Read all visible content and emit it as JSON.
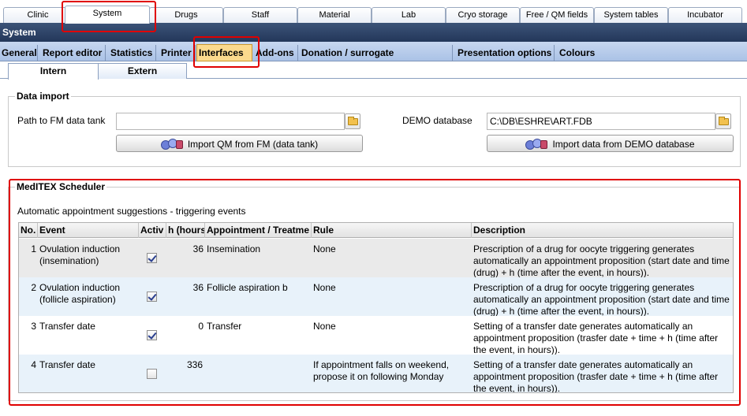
{
  "top_tabs": [
    "Clinic",
    "System",
    "Drugs",
    "Staff",
    "Material",
    "Lab",
    "Cryo storage",
    "Free / QM fields",
    "System tables",
    "Incubator"
  ],
  "active_top_tab": "System",
  "section_title": "System",
  "sub_tabs": [
    "General",
    "Report editor",
    "Statistics",
    "Printer",
    "Interfaces",
    "Add-ons",
    "Donation / surrogate motherhood",
    "Presentation options",
    "Colours"
  ],
  "active_sub_tab": "Interfaces",
  "third_tabs": [
    "Intern",
    "Extern"
  ],
  "active_third_tab": "Intern",
  "data_import": {
    "title": "Data import",
    "fm_label": "Path to FM data tank",
    "fm_value": "",
    "fm_button": "Import QM from FM (data tank)",
    "demo_label": "DEMO database",
    "demo_value": "C:\\DB\\ESHRE\\ART.FDB",
    "demo_button": "Import data from DEMO database"
  },
  "scheduler": {
    "title": "MedITEX Scheduler",
    "subtitle": "Automatic appointment suggestions - triggering events",
    "columns": [
      "No.",
      "Event",
      "Activ",
      "h (hours",
      "Appointment / Treatme",
      "Rule",
      "Description"
    ],
    "rows": [
      {
        "no": "1",
        "event": "Ovulation induction (insemination)",
        "active": true,
        "hours": "36",
        "appointment": "Insemination",
        "rule": "None",
        "description": "Prescription of a drug for oocyte triggering generates automatically an appointment proposition (start date and time (drug) + h (time after the event, in hours))."
      },
      {
        "no": "2",
        "event": "Ovulation induction (follicle aspiration)",
        "active": true,
        "hours": "36",
        "appointment": "Follicle aspiration b",
        "rule": "None",
        "description": "Prescription of a drug for oocyte triggering generates automatically an appointment proposition (start date and time (drug) + h (time after the event, in hours))."
      },
      {
        "no": "3",
        "event": "Transfer date",
        "active": true,
        "hours": "0",
        "appointment": "Transfer",
        "rule": "None",
        "description": "Setting of a transfer date generates automatically an appointment proposition (trasfer date + time + h (time after the event, in hours))."
      },
      {
        "no": "4",
        "event": "Transfer date",
        "active": false,
        "hours": "336",
        "appointment": "",
        "rule": "If appointment falls on weekend, propose it on following Monday",
        "description": "Setting of a transfer date generates automatically an appointment proposition (trasfer date + time + h (time after the event, in hours))."
      }
    ]
  },
  "colors": {
    "header_bar": "#2f4568",
    "sub_tab_bar": "#b8cceb",
    "active_sub_tab": "#fbd98d",
    "highlight_border": "#e00000",
    "row_odd": "#eaeaea",
    "row_even": "#e8f2fa"
  }
}
